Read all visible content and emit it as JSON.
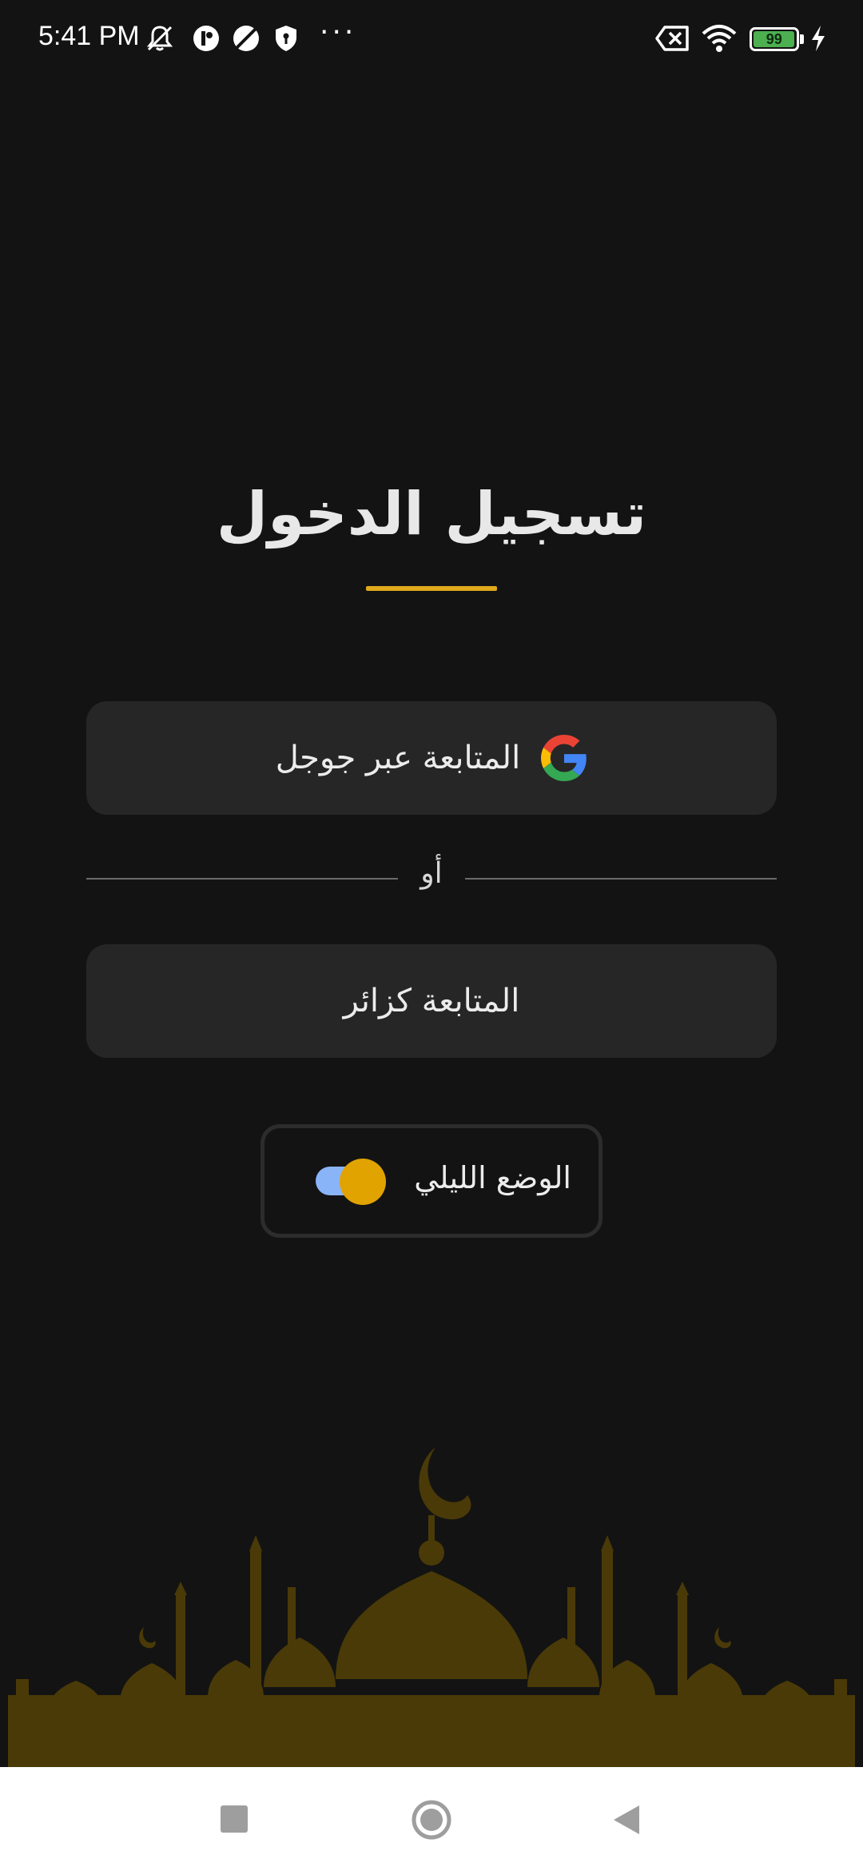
{
  "status_bar": {
    "time": "5:41 PM",
    "battery_level": "99",
    "icons": [
      "mute-icon",
      "app-icon",
      "vpn-icon",
      "shield-icon",
      "more-icon",
      "sim-off-icon",
      "wifi-icon",
      "battery-icon",
      "charging-icon"
    ]
  },
  "login": {
    "title": "تسجيل الدخول",
    "google_button_label": "المتابعة عبر جوجل",
    "divider_label": "أو",
    "guest_button_label": "المتابعة كزائر",
    "night_mode_label": "الوضع الليلي",
    "night_mode_enabled": true
  },
  "colors": {
    "background": "#131313",
    "accent": "#e0a81c",
    "button_bg": "#262626",
    "toggle_track": "#8ab4f8",
    "toggle_knob": "#e0a300",
    "mosque_silhouette": "#4a3a08"
  },
  "nav_bar": {
    "buttons": [
      "recents-button",
      "home-button",
      "back-button"
    ]
  }
}
